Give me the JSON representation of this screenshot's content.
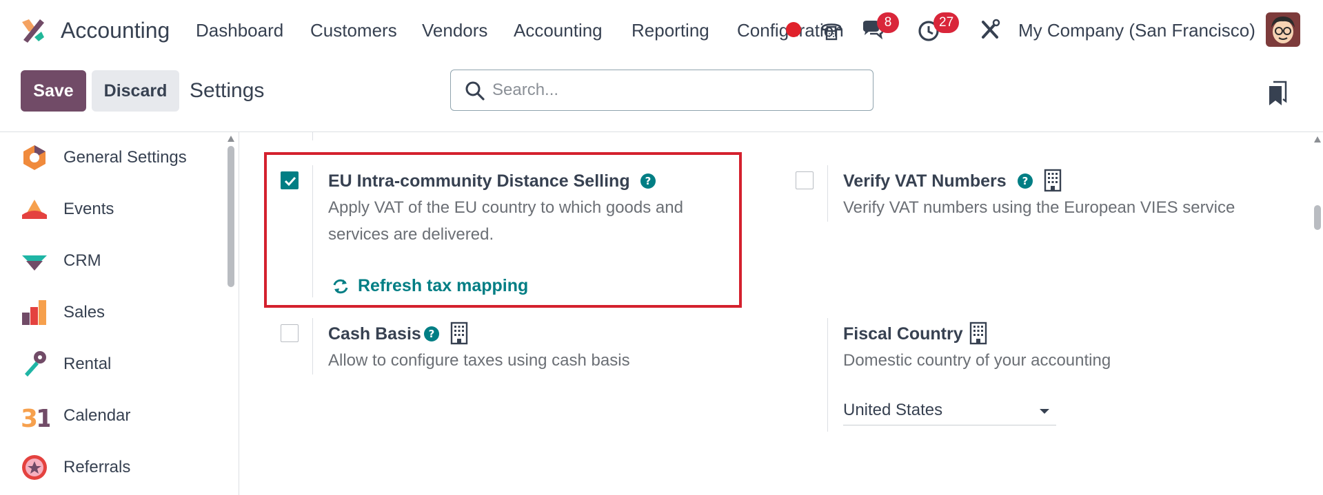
{
  "colors": {
    "brand": "#714b67",
    "accent": "#017e84",
    "badge": "#d9263a",
    "highlight_border": "#d4212e"
  },
  "topbar": {
    "app_icon": "accounting-app-icon",
    "app_name": "Accounting",
    "menu": [
      "Dashboard",
      "Customers",
      "Vendors",
      "Accounting",
      "Reporting",
      "Configuration"
    ],
    "icons": {
      "voip": "phone-icon",
      "messages": "chat-icon",
      "activities": "clock-icon",
      "debug": "tools-icon"
    },
    "messages_count": "8",
    "activities_count": "27",
    "company": "My Company (San Francisco)",
    "avatar_icon": "user-avatar"
  },
  "control_panel": {
    "save_label": "Save",
    "discard_label": "Discard",
    "title": "Settings",
    "search_placeholder": "Search...",
    "bookmark_icon": "bookmark-icon"
  },
  "sidebar": {
    "items": [
      {
        "label": "General Settings",
        "icon": "settings-app-icon"
      },
      {
        "label": "Events",
        "icon": "events-app-icon"
      },
      {
        "label": "CRM",
        "icon": "crm-app-icon"
      },
      {
        "label": "Sales",
        "icon": "sales-app-icon"
      },
      {
        "label": "Rental",
        "icon": "rental-app-icon"
      },
      {
        "label": "Calendar",
        "icon": "calendar-app-icon"
      },
      {
        "label": "Referrals",
        "icon": "referrals-app-icon"
      }
    ]
  },
  "settings": {
    "eu_distance": {
      "checked": true,
      "title": "EU Intra-community Distance Selling",
      "description": "Apply VAT of the EU country to which goods and services are delivered.",
      "link_label": "Refresh tax mapping"
    },
    "verify_vat": {
      "checked": false,
      "title": "Verify VAT Numbers",
      "description": "Verify VAT numbers using the European VIES service"
    },
    "cash_basis": {
      "checked": false,
      "title": "Cash Basis",
      "description": "Allow to configure taxes using cash basis"
    },
    "fiscal_country": {
      "title": "Fiscal Country",
      "description": "Domestic country of your accounting",
      "value": "United States"
    }
  }
}
